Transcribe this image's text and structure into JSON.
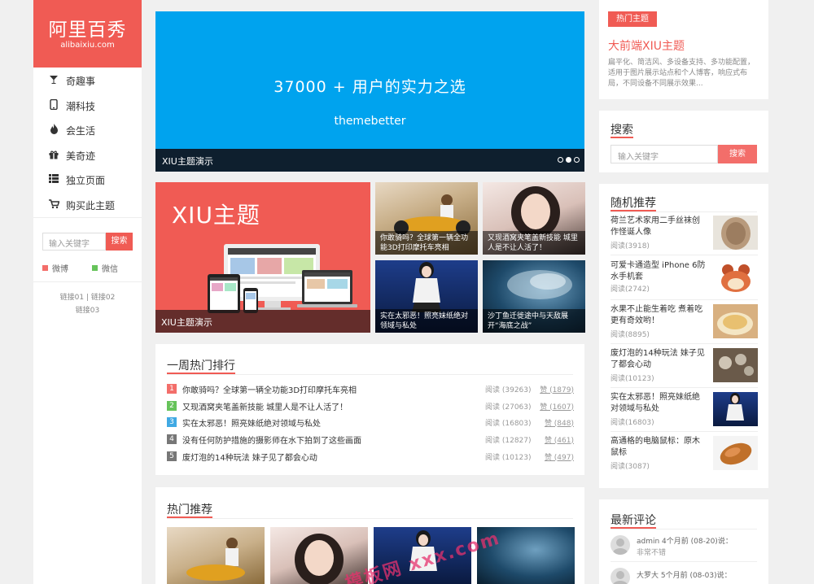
{
  "logo": {
    "title": "阿里百秀",
    "subtitle": "alibaixiu.com"
  },
  "nav": [
    {
      "label": "奇趣事",
      "icon": "glass-icon",
      "glyph": "🍸"
    },
    {
      "label": "潮科技",
      "icon": "mobile-icon",
      "glyph": "▯"
    },
    {
      "label": "会生活",
      "icon": "fire-icon",
      "glyph": "🔥"
    },
    {
      "label": "美奇迹",
      "icon": "gift-icon",
      "glyph": "🎁"
    },
    {
      "label": "独立页面",
      "icon": "list-icon",
      "glyph": "☰"
    },
    {
      "label": "购买此主题",
      "icon": "cart-icon",
      "glyph": "🛒"
    }
  ],
  "sidebar_search": {
    "placeholder": "输入关键字",
    "button": "搜索"
  },
  "share": {
    "weibo": "微博",
    "weixin": "微信"
  },
  "links": {
    "l1": "链接01",
    "sep": "|",
    "l2": "链接02",
    "l3": "链接03"
  },
  "hero": {
    "headline": "37000 +  用户的实力之选",
    "sub": "themebetter",
    "caption": "XIU主题演示",
    "active_slide": 2,
    "slides": 3
  },
  "feature": {
    "title": "XIU主题",
    "caption": "XIU主题演示"
  },
  "tiles": [
    {
      "caption": "你敢骑吗？全球第一辆全功能3D打印摩托车亮相"
    },
    {
      "caption": "又现酒窝夹笔盖新技能 城里人是不让人活了！"
    },
    {
      "caption": "实在太邪恶！照亮妹纸绝对领域与私处"
    },
    {
      "caption": "沙丁鱼迁徙途中与天敌展开“海底之战”"
    }
  ],
  "weekly": {
    "title": "一周热门排行",
    "rows": [
      {
        "rank": "1",
        "color": "#f36e6a",
        "title": "你敢骑吗？全球第一辆全功能3D打印摩托车亮相",
        "reads": "阅读 (39263)",
        "likes": "赞 (1879)"
      },
      {
        "rank": "2",
        "color": "#66c35a",
        "title": "又现酒窝夹笔盖新技能 城里人是不让人活了！",
        "reads": "阅读 (27063)",
        "likes": "赞 (1607)"
      },
      {
        "rank": "3",
        "color": "#40a9e3",
        "title": "实在太邪恶！照亮妹纸绝对领域与私处",
        "reads": "阅读 (16803)",
        "likes": "赞 (848)"
      },
      {
        "rank": "4",
        "color": "#777777",
        "title": "没有任何防护措施的摄影师在水下拍到了这些画面",
        "reads": "阅读 (12827)",
        "likes": "赞 (461)"
      },
      {
        "rank": "5",
        "color": "#777777",
        "title": "废灯泡的14种玩法 妹子见了都会心动",
        "reads": "阅读 (10123)",
        "likes": "赞 (497)"
      }
    ]
  },
  "hot": {
    "title": "热门推荐"
  },
  "hot_theme": {
    "tag": "热门主题",
    "title": "大前端XIU主题",
    "desc": "扁平化、简洁风、多设备支持、多功能配置，适用于图片展示站点和个人博客，响应式布局，不同设备不同展示效果..."
  },
  "search": {
    "title": "搜索",
    "placeholder": "输入关键字",
    "button": "搜索"
  },
  "random": {
    "title": "随机推荐",
    "items": [
      {
        "title": "荷兰艺术家用二手丝袜创作怪诞人像",
        "reads": "阅读(3918)"
      },
      {
        "title": "可爱卡通造型 iPhone 6防水手机套",
        "reads": "阅读(2742)"
      },
      {
        "title": "水果不止能生着吃 煮着吃更有奇效哟！",
        "reads": "阅读(8895)"
      },
      {
        "title": "废灯泡的14种玩法 妹子见了都会心动",
        "reads": "阅读(10123)"
      },
      {
        "title": "实在太邪恶！照亮妹纸绝对领域与私处",
        "reads": "阅读(16803)"
      },
      {
        "title": "高通格的电脑鼠标：原木鼠标",
        "reads": "阅读(3087)"
      }
    ]
  },
  "comments": {
    "title": "最新评论",
    "items": [
      {
        "meta": "admin 4个月前 (08-20)说：",
        "text": "非常不错"
      },
      {
        "meta": "大罗大 5个月前 (08-03)说：",
        "text": ""
      }
    ]
  },
  "watermark": "模板网 xxx.com",
  "colors": {
    "accent": "#f05b54",
    "hero_blue": "#00a3ee",
    "weibo": "#f36e6a",
    "weixin": "#66c35a"
  }
}
